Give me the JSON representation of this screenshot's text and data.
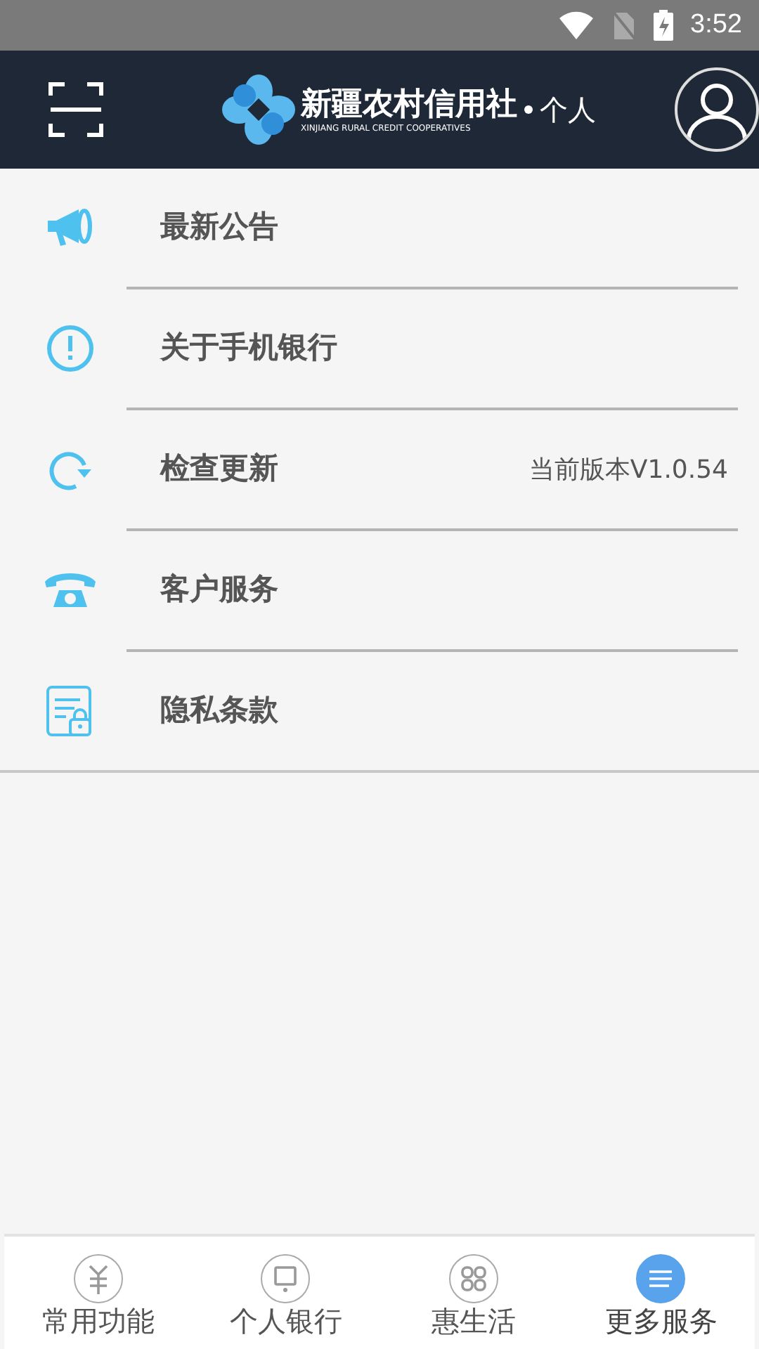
{
  "status_bar": {
    "time": "3:52"
  },
  "header": {
    "brand": "新疆农村信用社",
    "brand_en": "XINJIANG RURAL CREDIT COOPERATIVES",
    "section": "个人"
  },
  "menu": [
    {
      "kind": "notice",
      "label": "最新公告"
    },
    {
      "kind": "about",
      "label": "关于手机银行"
    },
    {
      "kind": "update",
      "label": "检查更新",
      "detail": "当前版本V1.0.54"
    },
    {
      "kind": "service",
      "label": "客户服务"
    },
    {
      "kind": "privacy",
      "label": "隐私条款"
    }
  ],
  "tabs": [
    {
      "kind": "common",
      "label": "常用功能",
      "selected": false
    },
    {
      "kind": "personal",
      "label": "个人银行",
      "selected": false
    },
    {
      "kind": "life",
      "label": "惠生活",
      "selected": false
    },
    {
      "kind": "more",
      "label": "更多服务",
      "selected": true
    }
  ]
}
